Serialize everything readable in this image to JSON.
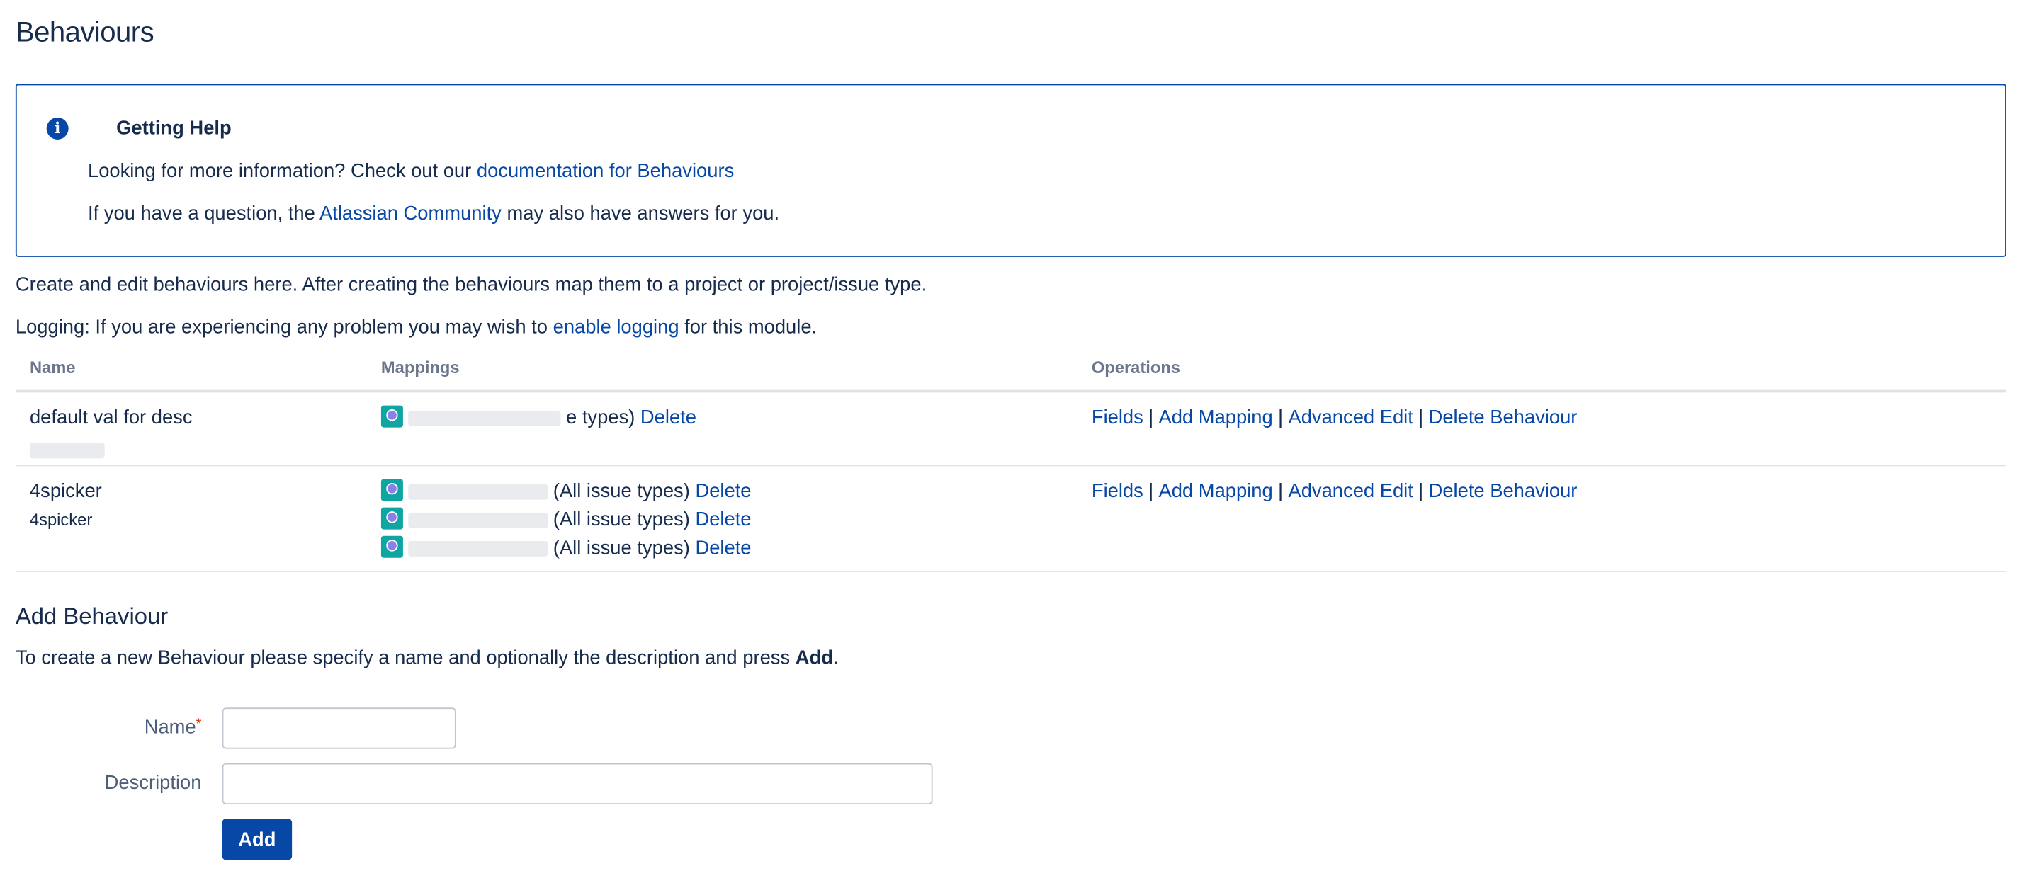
{
  "page": {
    "title": "Behaviours"
  },
  "help": {
    "title": "Getting Help",
    "line1_text": "Looking for more information? Check out our ",
    "line1_link": "documentation for Behaviours",
    "line2_pre": "If you have a question, the ",
    "line2_link": "Atlassian Community",
    "line2_post": " may also have answers for you."
  },
  "intro": {
    "p1": "Create and edit behaviours here. After creating the behaviours map them to a project or project/issue type.",
    "p2_pre": "Logging: If you are experiencing any problem you may wish to ",
    "p2_link": "enable logging",
    "p2_post": " for this module."
  },
  "table": {
    "headers": {
      "name": "Name",
      "mappings": "Mappings",
      "operations": "Operations"
    },
    "rows": [
      {
        "name": "default val for desc",
        "mappings": [
          {
            "suffix": "e types)",
            "delete": "Delete"
          }
        ],
        "ops": {
          "fields": "Fields",
          "add_mapping": "Add Mapping",
          "advanced_edit": "Advanced Edit",
          "delete_behaviour": "Delete Behaviour"
        }
      },
      {
        "name": "4spicker",
        "subname": "4spicker",
        "mappings": [
          {
            "suffix": "(All issue types)",
            "delete": "Delete"
          },
          {
            "suffix": "(All issue types)",
            "delete": "Delete"
          },
          {
            "suffix": "(All issue types)",
            "delete": "Delete"
          }
        ],
        "ops": {
          "fields": "Fields",
          "add_mapping": "Add Mapping",
          "advanced_edit": "Advanced Edit",
          "delete_behaviour": "Delete Behaviour"
        }
      }
    ],
    "separator": "|"
  },
  "add": {
    "title": "Add Behaviour",
    "desc_pre": "To create a new Behaviour please specify a name and optionally the description and press ",
    "desc_bold": "Add",
    "desc_post": ".",
    "name_label": "Name",
    "required_mark": "*",
    "desc_label": "Description",
    "name_value": "",
    "desc_value": "",
    "button": "Add"
  },
  "colors": {
    "link": "#0747a6",
    "primary_button": "#0747a6",
    "border": "#dfe1e6",
    "required": "#de350b"
  },
  "icons": {
    "info": "info-icon",
    "project": "project-avatar-icon"
  }
}
